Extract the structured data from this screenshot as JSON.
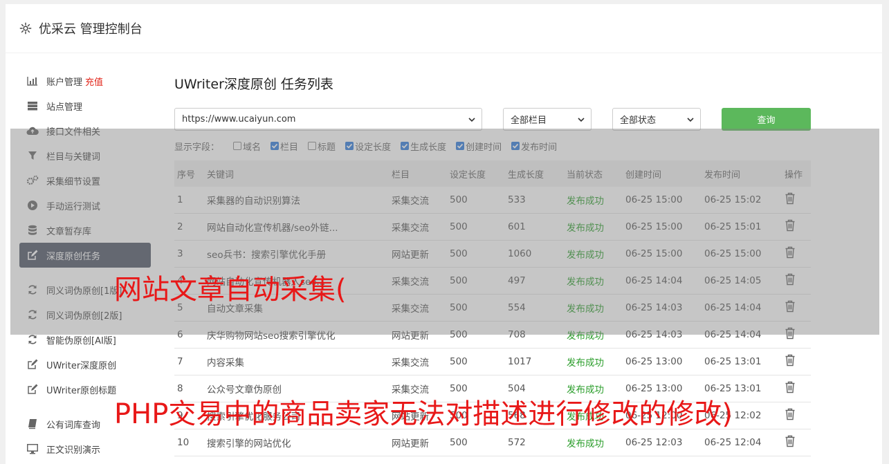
{
  "header": {
    "title": "优采云 管理控制台"
  },
  "sidebar": {
    "items": [
      {
        "icon": "bar-chart-icon",
        "label": "账户管理",
        "badge": "充值"
      },
      {
        "icon": "server-icon",
        "label": "站点管理"
      },
      {
        "icon": "cloud-upload-icon",
        "label": "接口文件相关"
      },
      {
        "icon": "filter-icon",
        "label": "栏目与关键词"
      },
      {
        "icon": "gears-icon",
        "label": "采集细节设置"
      },
      {
        "icon": "play-circle-icon",
        "label": "手动运行测试"
      },
      {
        "icon": "database-icon",
        "label": "文章暂存库"
      },
      {
        "icon": "edit-icon",
        "label": "深度原创任务",
        "active": true
      },
      {
        "icon": "refresh-icon",
        "label": "同义词伪原创[1版]"
      },
      {
        "icon": "refresh-icon",
        "label": "同义词伪原创[2版]"
      },
      {
        "icon": "refresh-icon",
        "label": "智能伪原创[AI版]"
      },
      {
        "icon": "edit-icon",
        "label": "UWriter深度原创"
      },
      {
        "icon": "edit-icon",
        "label": "UWriter原创标题"
      },
      {
        "icon": "book-icon",
        "label": "公有词库查询"
      },
      {
        "icon": "monitor-icon",
        "label": "正文识别演示"
      }
    ]
  },
  "content": {
    "title": "UWriter深度原创 任务列表",
    "site_select": "https://www.ucaiyun.com",
    "column_select": "全部栏目",
    "status_select": "全部状态",
    "query_button": "查询",
    "fields_label": "显示字段：",
    "fields": [
      {
        "label": "域名",
        "checked": false
      },
      {
        "label": "栏目",
        "checked": true
      },
      {
        "label": "标题",
        "checked": false
      },
      {
        "label": "设定长度",
        "checked": true
      },
      {
        "label": "生成长度",
        "checked": true
      },
      {
        "label": "创建时间",
        "checked": true
      },
      {
        "label": "发布时间",
        "checked": true
      }
    ],
    "table": {
      "headers": [
        "序号",
        "关键词",
        "栏目",
        "设定长度",
        "生成长度",
        "当前状态",
        "创建时间",
        "发布时间",
        "操作"
      ],
      "rows": [
        [
          "1",
          "采集器的自动识别算法",
          "采集交流",
          "500",
          "533",
          "发布成功",
          "06-25 15:00",
          "06-25 15:02"
        ],
        [
          "2",
          "网站自动化宣传机器/seo外链...",
          "采集交流",
          "500",
          "601",
          "发布成功",
          "06-25 15:00",
          "06-25 15:01"
        ],
        [
          "3",
          "seo兵书：搜索引擎优化手册",
          "网站更新",
          "500",
          "1060",
          "发布成功",
          "06-25 15:00",
          "06-25 15:00"
        ],
        [
          "4",
          "网站自动化宣传机器人seo...",
          "采集交流",
          "500",
          "497",
          "发布成功",
          "06-25 14:04",
          "06-25 14:05"
        ],
        [
          "5",
          "自动文章采集",
          "采集交流",
          "500",
          "554",
          "发布成功",
          "06-25 14:03",
          "06-25 14:04"
        ],
        [
          "6",
          "庆华购物网站seo搜索引擎优化",
          "网站更新",
          "500",
          "708",
          "发布成功",
          "06-25 14:03",
          "06-25 14:04"
        ],
        [
          "7",
          "内容采集",
          "采集交流",
          "500",
          "1017",
          "发布成功",
          "06-25 13:00",
          "06-25 13:01"
        ],
        [
          "8",
          "公众号文章伪原创",
          "采集交流",
          "500",
          "504",
          "发布成功",
          "06-25 13:00",
          "06-25 13:01"
        ],
        [
          "9",
          "搜索引擎优化服务公司",
          "网站更新",
          "500",
          "568",
          "发布成功",
          "06-25 12:00",
          "06-25 12:02"
        ],
        [
          "10",
          "搜索引擎的网站优化",
          "网站更新",
          "500",
          "572",
          "发布成功",
          "06-25 12:03",
          "06-25 12:04"
        ]
      ]
    }
  },
  "watermark": {
    "line1": "网站文章自动采集(",
    "line2": "PHP交易中的商品卖家无法对描述进行修改的修改)"
  },
  "colors": {
    "accent": "#5cb85c",
    "active_bg": "#4e5565",
    "success": "#2a9d2a",
    "badge": "#e2261b",
    "watermark": "#e81818"
  }
}
